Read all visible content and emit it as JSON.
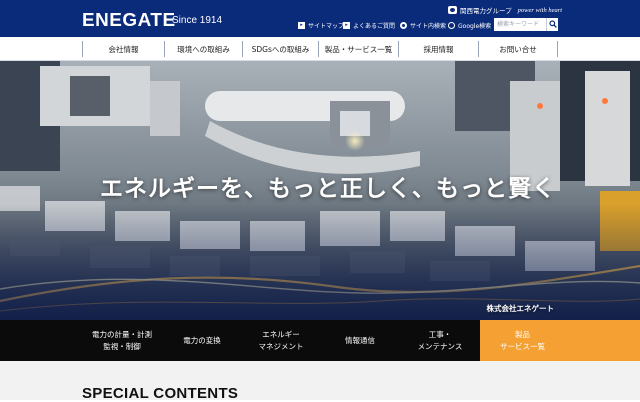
{
  "header": {
    "logo": "ENEGATE",
    "since": "Since 1914",
    "group_label": "関西電力グループ",
    "slogan": "power with heart",
    "sitemap_label": "サイトマップ",
    "faq_label": "よくあるご質問",
    "search_site_label": "サイト内検索",
    "search_google_label": "Google検索",
    "search_placeholder": "検索キーワード",
    "icons": {
      "group": "kansai-logo-icon",
      "sitemap": "sitemap-icon",
      "faq": "faq-icon",
      "search": "search-icon"
    },
    "bg_color": "#0a2a7a"
  },
  "nav": {
    "items": [
      {
        "label": "会社情報"
      },
      {
        "label": "環境への取組み"
      },
      {
        "label": "SDGsへの取組み"
      },
      {
        "label": "製品・サービス一覧"
      },
      {
        "label": "採用情報"
      },
      {
        "label": "お問い合せ"
      }
    ]
  },
  "hero": {
    "title": "エネルギーを、もっと正しく、もっと賢く",
    "company": "株式会社エネゲート"
  },
  "categories": {
    "items": [
      {
        "label": "電力の計量・計測\n監視・制御"
      },
      {
        "label": "電力の変換"
      },
      {
        "label": "エネルギー\nマネジメント"
      },
      {
        "label": "情報通信"
      },
      {
        "label": "工事・\nメンテナンス"
      },
      {
        "label": "製品\nサービス一覧"
      }
    ],
    "active_color": "#f5a033"
  },
  "special": {
    "title": "SPECIAL CONTENTS"
  }
}
